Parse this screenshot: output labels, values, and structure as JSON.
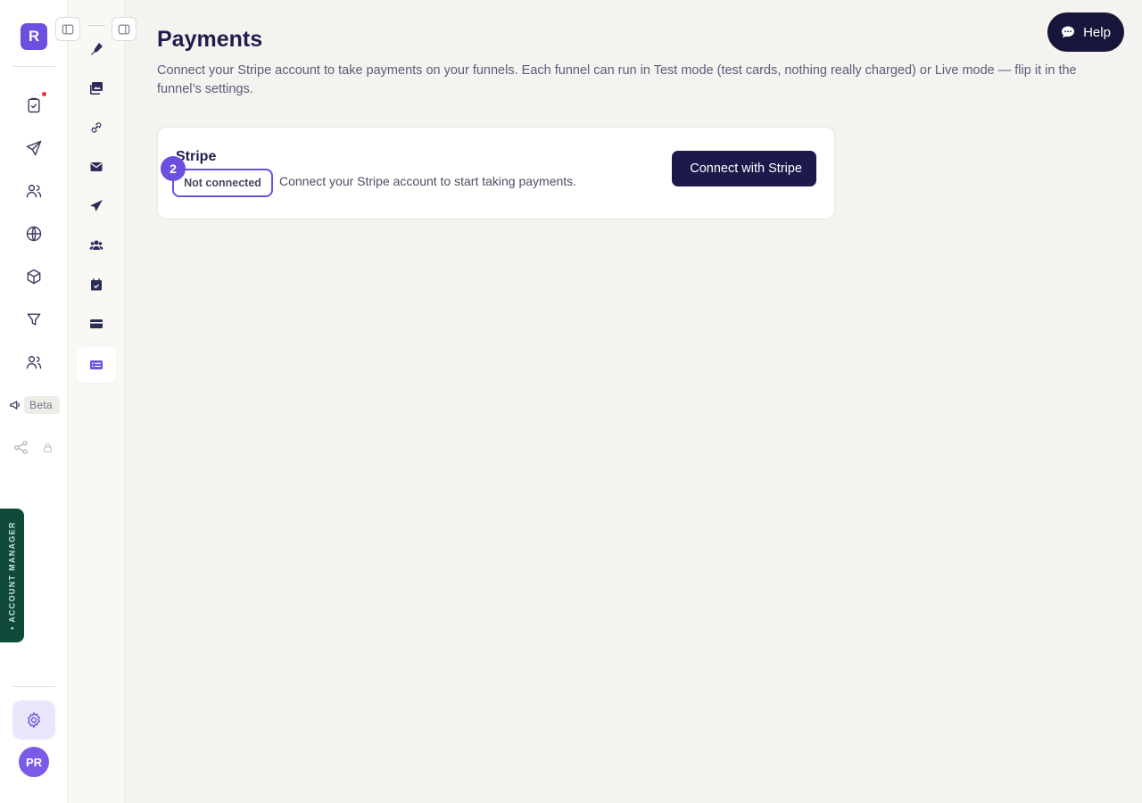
{
  "app": {
    "logo_letter": "R",
    "avatar_initials": "PR"
  },
  "rail": {
    "beta_label": "Beta",
    "account_manager_label": "• ACCOUNT MANAGER",
    "icons": [
      "checklist-icon",
      "send-icon",
      "users-icon",
      "globe-icon",
      "box-icon",
      "filter-icon",
      "team-icon",
      "megaphone-icon",
      "share-icon",
      "lock-icon",
      "gear-icon"
    ]
  },
  "subrail": {
    "icons": [
      "pen-tool-icon",
      "gallery-icon",
      "link-icon",
      "envelope-icon",
      "paper-plane-icon",
      "people-group-icon",
      "calendar-check-icon",
      "credit-card-icon",
      "list-card-icon"
    ],
    "active": "list-card-icon"
  },
  "page": {
    "title": "Payments",
    "description": "Connect your Stripe account to take payments on your funnels. Each funnel can run in Test mode (test cards, nothing really charged) or Live mode — flip it in the funnel’s settings."
  },
  "stripe_card": {
    "title": "Stripe",
    "status": "Not connected",
    "step_number": "2",
    "subtitle": "Connect your Stripe account to start taking payments.",
    "connect_label": "Connect with Stripe"
  },
  "help": {
    "label": "Help"
  },
  "colors": {
    "accent": "#6d4fe0",
    "navy": "#1c1a4a",
    "account_manager": "#0f4a3b",
    "notification": "#e0334a"
  }
}
